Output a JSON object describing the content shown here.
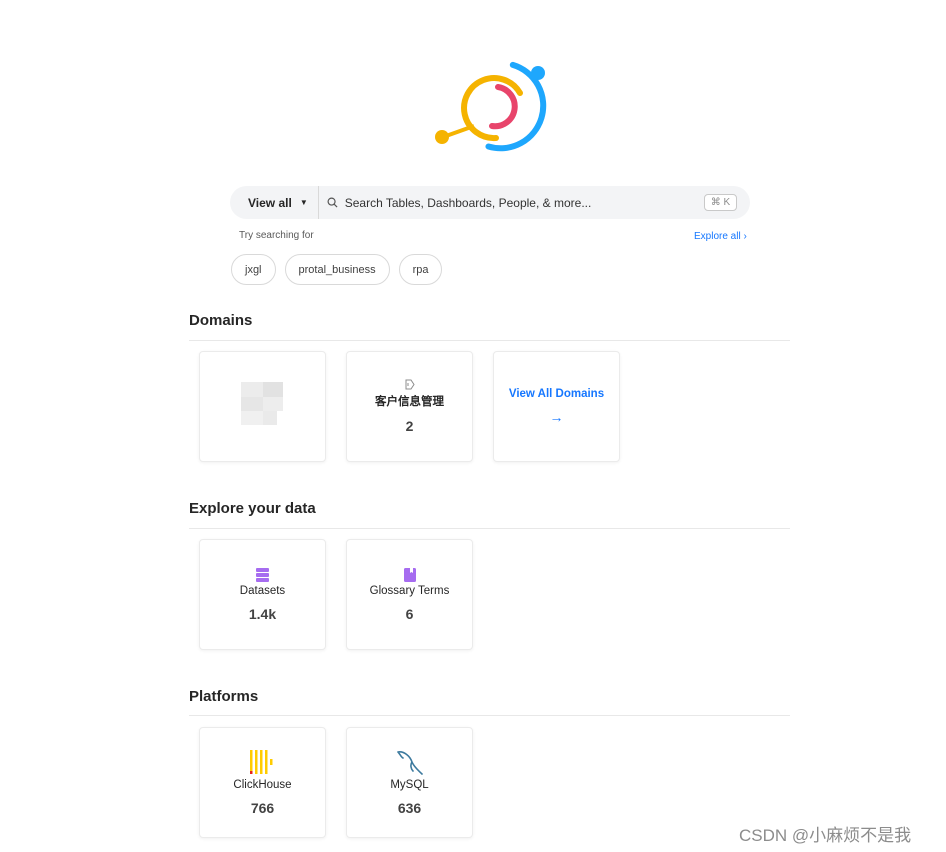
{
  "search": {
    "scope_label": "View all",
    "placeholder": "Search Tables, Dashboards, People, & more...",
    "shortcut": "⌘ K"
  },
  "suggestions": {
    "label": "Try searching for",
    "explore_label": "Explore all",
    "chips": [
      "jxgl",
      "protal_business",
      "rpa"
    ]
  },
  "domains": {
    "title": "Domains",
    "cards": [
      {
        "name": "客户信息管理",
        "count": "2"
      }
    ],
    "view_all_label": "View All Domains"
  },
  "explore": {
    "title": "Explore your data",
    "cards": [
      {
        "name": "Datasets",
        "count": "1.4k",
        "icon": "datasets-icon"
      },
      {
        "name": "Glossary Terms",
        "count": "6",
        "icon": "glossary-icon"
      }
    ]
  },
  "platforms": {
    "title": "Platforms",
    "cards": [
      {
        "name": "ClickHouse",
        "count": "766",
        "icon": "clickhouse-icon"
      },
      {
        "name": "MySQL",
        "count": "636",
        "icon": "mysql-icon"
      }
    ]
  },
  "watermark": "CSDN @小麻烦不是我",
  "colors": {
    "accent_blue": "#1677ff",
    "logo_blue": "#1ea7fd",
    "logo_yellow": "#f5b300",
    "logo_pink": "#e8446b",
    "purple_icon": "#a66cf0",
    "clickhouse_yellow": "#ffcc00"
  }
}
